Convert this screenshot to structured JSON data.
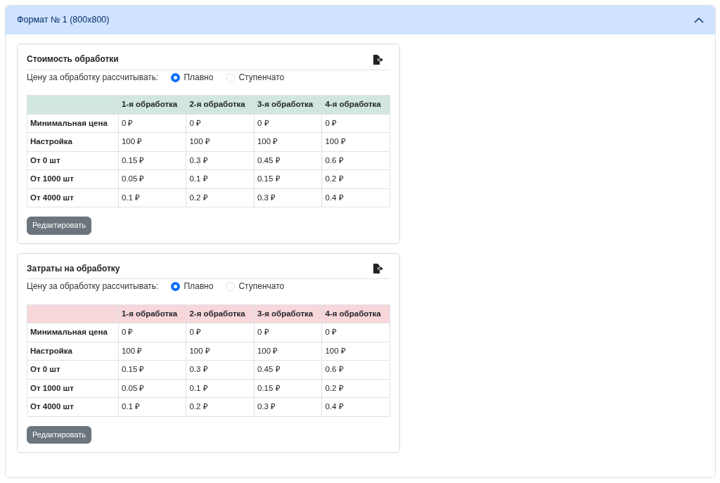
{
  "accordion": {
    "title": "Формат № 1 (800x800)",
    "expanded": true
  },
  "panels": [
    {
      "title": "Стоимость обработки",
      "color": "#d1e7dd",
      "mode_label": "Цену за обработку рассчитывать:",
      "options": [
        {
          "label": "Плавно",
          "selected": true
        },
        {
          "label": "Ступенчато",
          "selected": false
        }
      ],
      "columns": [
        "1-я обработка",
        "2-я обработка",
        "3-я обработка",
        "4-я обработка"
      ],
      "rows": [
        {
          "label": "Минимальная цена",
          "cells": [
            "0 ₽",
            "0 ₽",
            "0 ₽",
            "0 ₽"
          ]
        },
        {
          "label": "Настройка",
          "cells": [
            "100 ₽",
            "100 ₽",
            "100 ₽",
            "100 ₽"
          ]
        },
        {
          "label": "От 0 шт",
          "cells": [
            "0.15 ₽",
            "0.3 ₽",
            "0.45 ₽",
            "0.6 ₽"
          ]
        },
        {
          "label": "От 1000 шт",
          "cells": [
            "0.05 ₽",
            "0.1 ₽",
            "0.15 ₽",
            "0.2 ₽"
          ]
        },
        {
          "label": "От 4000 шт",
          "cells": [
            "0.1 ₽",
            "0.2 ₽",
            "0.3 ₽",
            "0.4 ₽"
          ]
        }
      ],
      "button": "Редактировать"
    },
    {
      "title": "Затраты на обработку",
      "color": "#f8d7da",
      "mode_label": "Цену за обработку рассчитывать:",
      "options": [
        {
          "label": "Плавно",
          "selected": true
        },
        {
          "label": "Ступенчато",
          "selected": false
        }
      ],
      "columns": [
        "1-я обработка",
        "2-я обработка",
        "3-я обработка",
        "4-я обработка"
      ],
      "rows": [
        {
          "label": "Минимальная цена",
          "cells": [
            "0 ₽",
            "0 ₽",
            "0 ₽",
            "0 ₽"
          ]
        },
        {
          "label": "Настройка",
          "cells": [
            "100 ₽",
            "100 ₽",
            "100 ₽",
            "100 ₽"
          ]
        },
        {
          "label": "От 0 шт",
          "cells": [
            "0.15 ₽",
            "0.3 ₽",
            "0.45 ₽",
            "0.6 ₽"
          ]
        },
        {
          "label": "От 1000 шт",
          "cells": [
            "0.05 ₽",
            "0.1 ₽",
            "0.15 ₽",
            "0.2 ₽"
          ]
        },
        {
          "label": "От 4000 шт",
          "cells": [
            "0.1 ₽",
            "0.2 ₽",
            "0.3 ₽",
            "0.4 ₽"
          ]
        }
      ],
      "button": "Редактировать"
    }
  ]
}
